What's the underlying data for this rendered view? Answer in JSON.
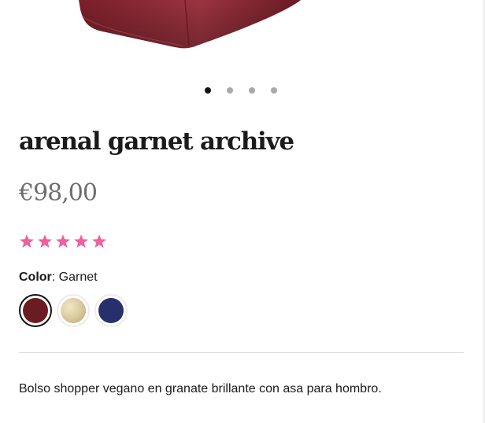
{
  "product": {
    "title": "arenal garnet archive",
    "price": "€98,00",
    "rating": 5,
    "rating_color": "#f0609e",
    "color_label": "Color",
    "color_value": ": Garnet",
    "description": "Bolso shopper vegano en granate brillante con asa para hombro."
  },
  "carousel": {
    "count": 4,
    "active_index": 0
  },
  "swatches": [
    {
      "name": "Garnet",
      "color": "#6a1c22",
      "selected": true
    },
    {
      "name": "Gold",
      "color": "#d9c79b",
      "selected": false
    },
    {
      "name": "Navy",
      "color": "#27306b",
      "selected": false
    }
  ],
  "image": {
    "bag_color": "#8b2a35"
  }
}
